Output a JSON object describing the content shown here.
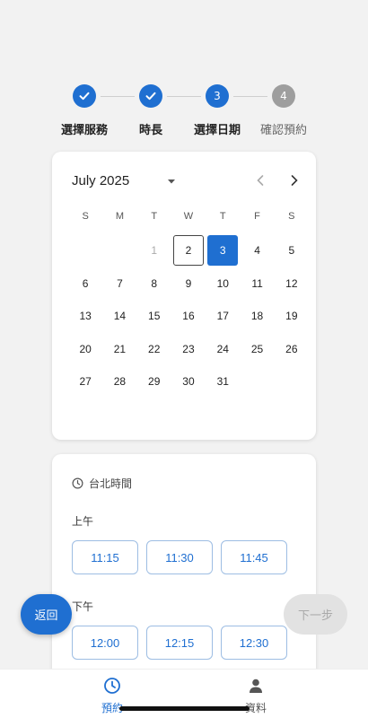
{
  "stepper": {
    "steps": [
      {
        "label": "選擇服務",
        "state": "done",
        "number": ""
      },
      {
        "label": "時長",
        "state": "done",
        "number": ""
      },
      {
        "label": "選擇日期",
        "state": "active",
        "number": "3"
      },
      {
        "label": "確認預約",
        "state": "pending",
        "number": "4"
      }
    ]
  },
  "calendar": {
    "month_label": "July 2025",
    "weekdays": [
      "S",
      "M",
      "T",
      "W",
      "T",
      "F",
      "S"
    ],
    "weeks": [
      [
        "",
        "",
        "1",
        "2",
        "3",
        "4",
        "5"
      ],
      [
        "6",
        "7",
        "8",
        "9",
        "10",
        "11",
        "12"
      ],
      [
        "13",
        "14",
        "15",
        "16",
        "17",
        "18",
        "19"
      ],
      [
        "20",
        "21",
        "22",
        "23",
        "24",
        "25",
        "26"
      ],
      [
        "27",
        "28",
        "29",
        "30",
        "31",
        "",
        ""
      ]
    ],
    "past_day": "1",
    "today_day": "2",
    "selected_day": "3"
  },
  "time": {
    "timezone": "台北時間",
    "morning_label": "上午",
    "morning_slots": [
      "11:15",
      "11:30",
      "11:45"
    ],
    "afternoon_label": "下午",
    "afternoon_slots": [
      "12:00",
      "12:15",
      "12:30"
    ]
  },
  "actions": {
    "back_label": "返回",
    "next_label": "下一步"
  },
  "bottom_nav": {
    "booking_label": "預約",
    "profile_label": "資料"
  },
  "colors": {
    "accent": "#1f6fd1",
    "pending": "#9e9e9e"
  }
}
